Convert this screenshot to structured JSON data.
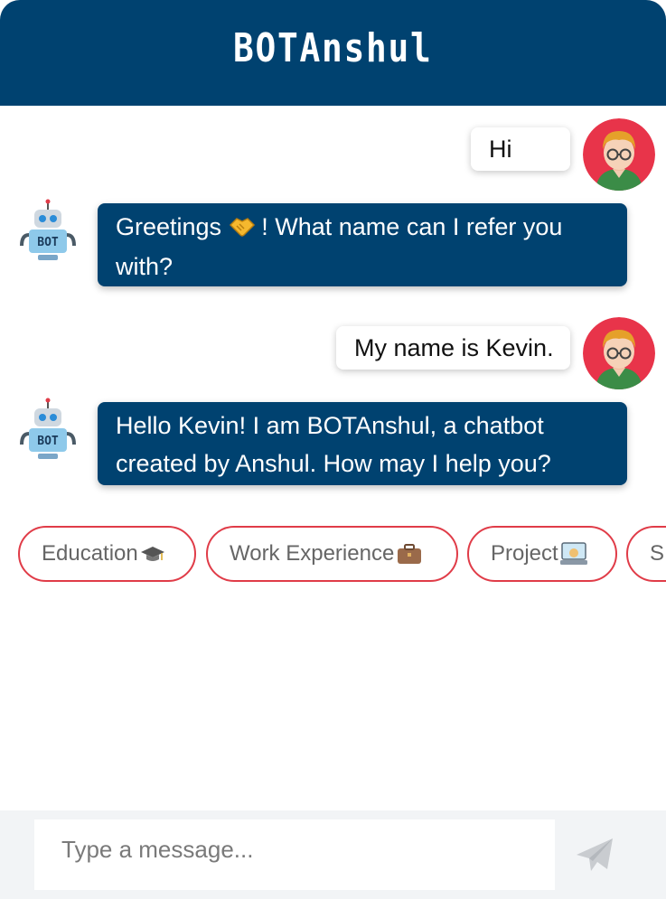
{
  "header": {
    "title": "BOTAnshul"
  },
  "messages": [
    {
      "sender": "user",
      "text": "Hi"
    },
    {
      "sender": "bot",
      "text_line1": "Greetings",
      "text_line1_rest": "! What name can I refer you",
      "text_line2": "with?",
      "emoji": "handshake-icon"
    },
    {
      "sender": "user",
      "text": "My name is Kevin."
    },
    {
      "sender": "bot",
      "text_line1": "Hello Kevin! I am BOTAnshul, a chatbot",
      "text_line2": "created by Anshul. How may I help you?"
    }
  ],
  "quick_replies": [
    {
      "label": "Education",
      "icon": "graduation-cap-icon"
    },
    {
      "label": "Work Experience",
      "icon": "briefcase-icon"
    },
    {
      "label": "Project",
      "icon": "laptop-code-icon"
    },
    {
      "label": "S",
      "icon": ""
    }
  ],
  "composer": {
    "placeholder": "Type a message...",
    "send_icon": "paper-plane-icon"
  },
  "colors": {
    "primary": "#004270",
    "chip_border": "#e03c48",
    "avatar_bg": "#e8344a"
  }
}
